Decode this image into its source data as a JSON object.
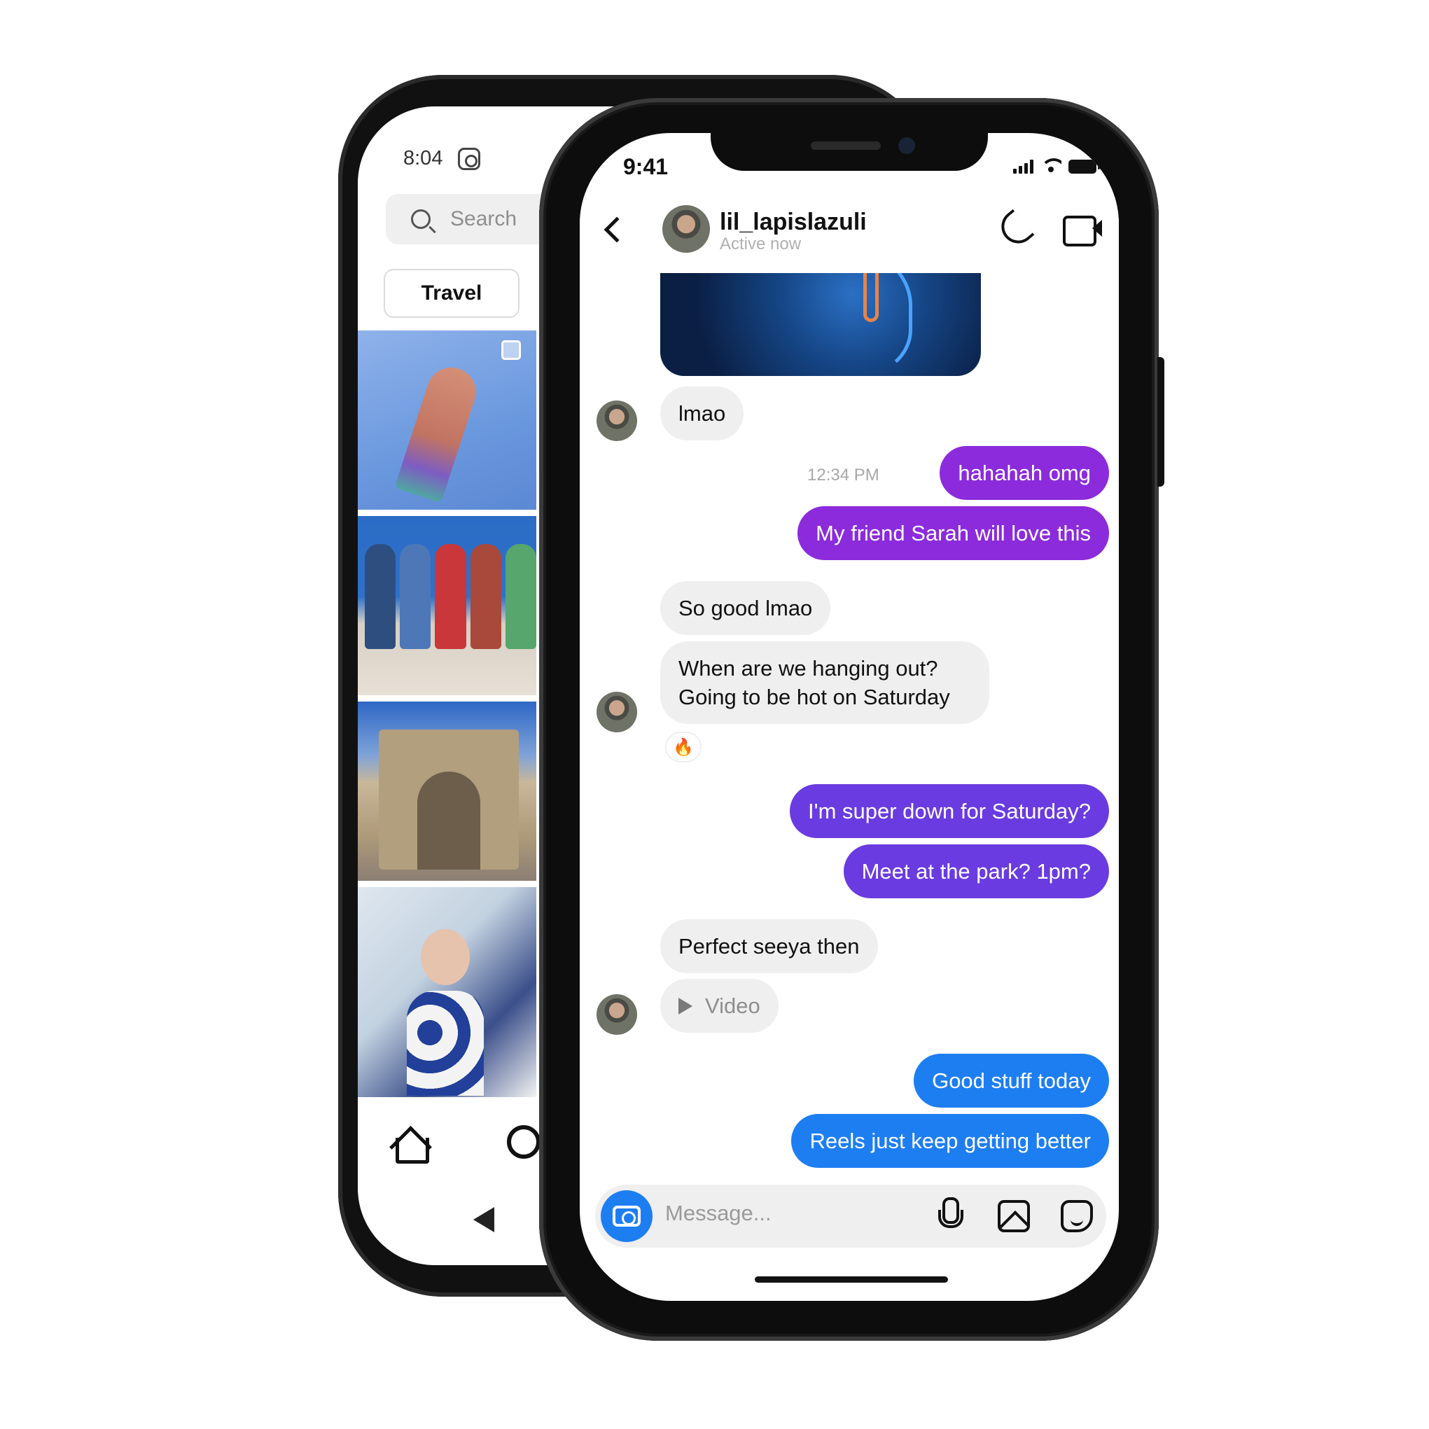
{
  "back_phone": {
    "status_time": "8:04",
    "search_placeholder": "Search",
    "chip_label": "Travel"
  },
  "front_phone": {
    "status_time": "9:41",
    "header": {
      "username": "lil_lapislazuli",
      "status": "Active now"
    },
    "messages": {
      "m1": "lmao",
      "timestamp": "12:34 PM",
      "m2": "hahahah omg",
      "m3": "My friend Sarah will love this",
      "m4": "So good lmao",
      "m5_line1": "When are we hanging out?",
      "m5_line2": "Going to be hot on Saturday",
      "reaction": "🔥",
      "m6": "I'm super down for Saturday?",
      "m7": "Meet at the park? 1pm?",
      "m8": "Perfect seeya then",
      "m9": "Video",
      "m10": "Good stuff today",
      "m11": "Reels just keep getting better"
    },
    "composer_placeholder": "Message...",
    "colors": {
      "purple": "#8b2bdc",
      "violet": "#6a3be0",
      "blue": "#1d7ef2",
      "incoming": "#efefef"
    }
  }
}
